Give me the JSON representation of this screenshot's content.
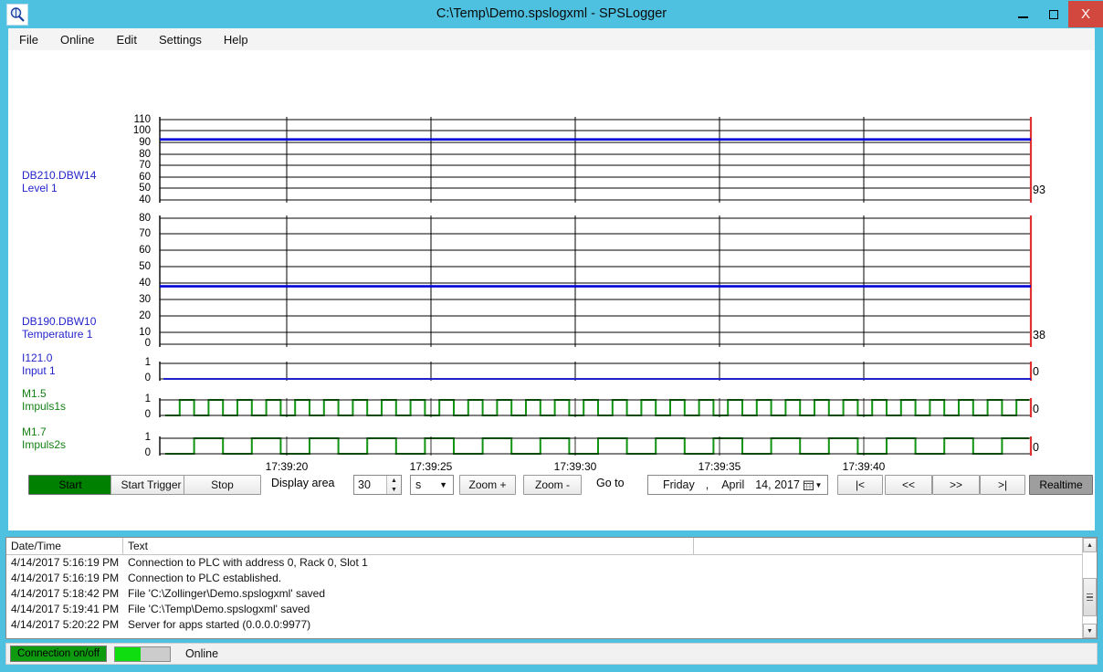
{
  "window": {
    "title": "C:\\Temp\\Demo.spslogxml - SPSLogger",
    "icon": "magnifier-icon",
    "minimize": "–",
    "maximize": "□",
    "close": "X",
    "frame_color": "#4fc1e0"
  },
  "menu": {
    "items": [
      {
        "label": "File"
      },
      {
        "label": "Online"
      },
      {
        "label": "Edit"
      },
      {
        "label": "Settings"
      },
      {
        "label": "Help"
      }
    ]
  },
  "chart_data": {
    "type": "line",
    "title": "",
    "xlabel": "",
    "ylabel": "",
    "date": "4/14/2017",
    "x_tick_labels": [
      "17:39:20",
      "17:39:25",
      "17:39:30",
      "17:39:35",
      "17:39:40"
    ],
    "grid": true,
    "legend_position": "left",
    "plots": [
      {
        "signal": "DB210.DBW14",
        "name": "Level 1",
        "label_color": "#2424cc",
        "trace_color": "#0000d8",
        "kind": "analog",
        "ylim": [
          40,
          110
        ],
        "yticks": [
          40,
          50,
          60,
          70,
          80,
          90,
          100,
          110
        ],
        "current_value": "93",
        "value": 93,
        "constant": true
      },
      {
        "signal": "DB190.DBW10",
        "name": "Temperature 1",
        "label_color": "#2424cc",
        "trace_color": "#0000d8",
        "kind": "analog",
        "ylim": [
          0,
          80
        ],
        "yticks": [
          0,
          10,
          20,
          30,
          40,
          50,
          60,
          70,
          80
        ],
        "current_value": "38",
        "value": 38,
        "constant": true
      },
      {
        "signal": "I121.0",
        "name": "Input 1",
        "label_color": "#2424cc",
        "trace_color": "#0000d8",
        "kind": "digital",
        "ylim": [
          0,
          1
        ],
        "yticks": [
          0,
          1
        ],
        "current_value": "0",
        "value": 0,
        "constant": true
      },
      {
        "signal": "M1.5",
        "name": "Impuls1s",
        "label_color": "#148014",
        "trace_color": "#119411",
        "kind": "digital",
        "ylim": [
          0,
          1
        ],
        "yticks": [
          0,
          1
        ],
        "current_value": "0",
        "period_seconds": 1,
        "constant": false
      },
      {
        "signal": "M1.7",
        "name": "Impuls2s",
        "label_color": "#148014",
        "trace_color": "#119411",
        "kind": "digital",
        "ylim": [
          0,
          1
        ],
        "yticks": [
          0,
          1
        ],
        "current_value": "0",
        "period_seconds": 2,
        "constant": false
      }
    ]
  },
  "toolbar": {
    "start_label": "Start",
    "start_trigger_label": "Start Trigger",
    "stop_label": "Stop",
    "display_area_label": "Display area",
    "display_area_value": "30",
    "display_area_unit": "s",
    "zoom_in_label": "Zoom +",
    "zoom_out_label": "Zoom -",
    "goto_label": "Go to",
    "date_weekday": "Friday",
    "date_comma": ",",
    "date_month": "April",
    "date_daynum": "14, 2017",
    "calendar_icon": "calendar-icon",
    "nav_first_label": "|<",
    "nav_prev_label": "<<",
    "nav_next_label": ">>",
    "nav_last_label": ">|",
    "realtime_label": "Realtime"
  },
  "log": {
    "columns": [
      "Date/Time",
      "Text"
    ],
    "rows": [
      {
        "datetime": "4/14/2017 5:16:19 PM",
        "text": "Connection to PLC with address 0, Rack 0, Slot 1"
      },
      {
        "datetime": "4/14/2017 5:16:19 PM",
        "text": "Connection to PLC established."
      },
      {
        "datetime": "4/14/2017 5:18:42 PM",
        "text": "File 'C:\\Zollinger\\Demo.spslogxml' saved"
      },
      {
        "datetime": "4/14/2017 5:19:41 PM",
        "text": "File 'C:\\Temp\\Demo.spslogxml' saved"
      },
      {
        "datetime": "4/14/2017 5:20:22 PM",
        "text": "Server for apps started (0.0.0.0:9977)"
      }
    ],
    "scroll_up": "▲",
    "scroll_down": "▼"
  },
  "status": {
    "connection_button": "Connection on/off",
    "indicator": "green",
    "text": "Online"
  }
}
